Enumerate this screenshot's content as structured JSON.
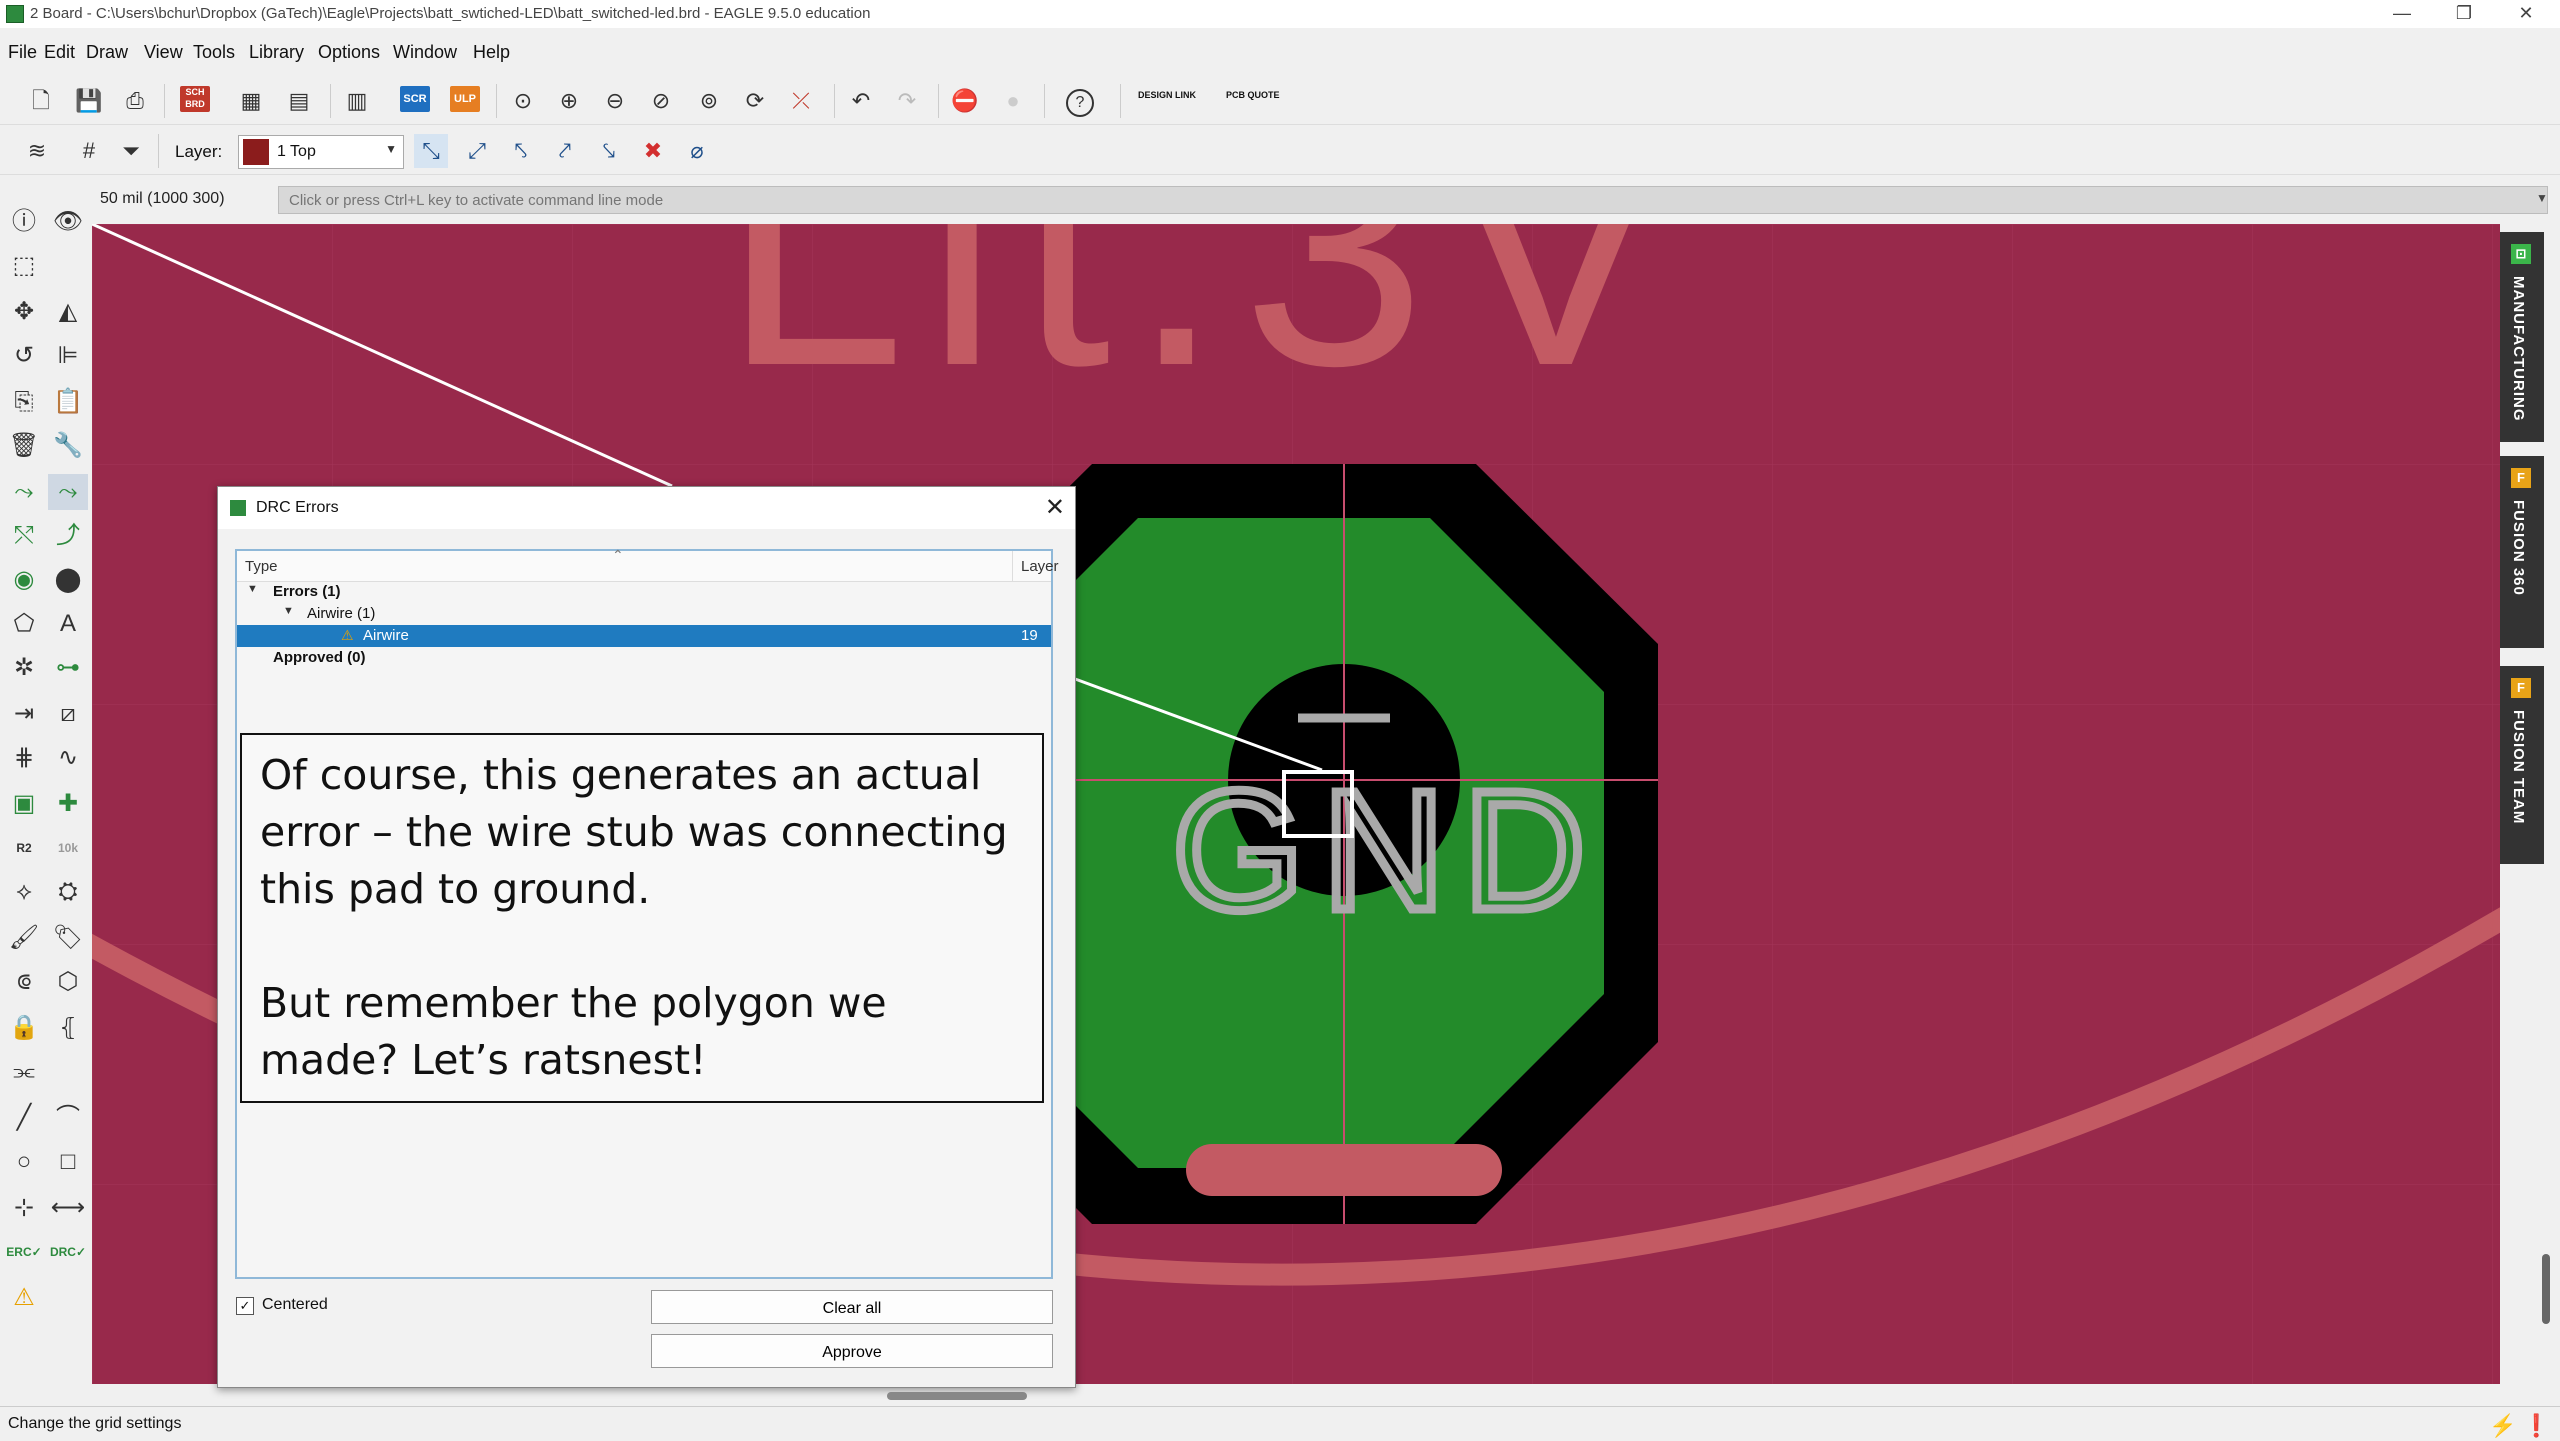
{
  "window": {
    "title": "2 Board - C:\\Users\\bchur\\Dropbox (GaTech)\\Eagle\\Projects\\batt_swtiched-LED\\batt_switched-led.brd - EAGLE 9.5.0 education",
    "minimize_glyph": "—",
    "restore_glyph": "❐",
    "close_glyph": "✕"
  },
  "menu": [
    "File",
    "Edit",
    "Draw",
    "View",
    "Tools",
    "Library",
    "Options",
    "Window",
    "Help"
  ],
  "toolbar": {
    "sch_brd": "SCH BRD",
    "scr": "SCR",
    "ulp": "ULP",
    "design_link": "DESIGN LINK",
    "pcb_quote": "PCB QUOTE",
    "help_glyph": "?"
  },
  "layer_bar": {
    "label": "Layer:",
    "selected": "1 Top",
    "color": "#8b1c1c"
  },
  "command_line": {
    "coordinates": "50 mil (1000 300)",
    "placeholder": "Click or press Ctrl+L key to activate command line mode"
  },
  "canvas": {
    "background": "#98294b",
    "silkscreen_text": "Lit.3V",
    "pad_label": "GND",
    "pad_fill": "#238b2a",
    "silkscreen_color": "#c35a63"
  },
  "side_tabs": [
    {
      "label": "MANUFACTURING",
      "icon": "manufacturing-icon",
      "icon_glyph": "⊡"
    },
    {
      "label": "FUSION 360",
      "icon": "fusion-icon",
      "icon_glyph": "F"
    },
    {
      "label": "FUSION TEAM",
      "icon": "fusion-team-icon",
      "icon_glyph": "F"
    }
  ],
  "drc_dialog": {
    "title": "DRC Errors",
    "columns": {
      "type": "Type",
      "layer": "Layer"
    },
    "tree": {
      "errors": "Errors (1)",
      "airwire_group": "Airwire (1)",
      "airwire_item": "Airwire",
      "airwire_layer": "19",
      "approved": "Approved (0)"
    },
    "callout_text": "Of course, this generates an actual error – the wire stub was connecting this pad to ground.\n\nBut remember the polygon we made? Let’s ratsnest!",
    "centered_label": "Centered",
    "centered_checked": true,
    "clear_all": "Clear all",
    "approve": "Approve"
  },
  "status_bar": {
    "text": "Change the grid settings"
  }
}
